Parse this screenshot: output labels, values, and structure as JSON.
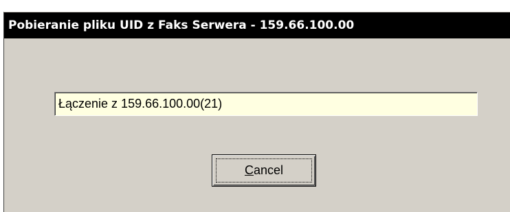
{
  "window": {
    "title": "Pobieranie pliku UID z Faks Serwera - 159.66.100.00"
  },
  "status": {
    "text": "Łączenie z 159.66.100.00(21)"
  },
  "buttons": {
    "cancel": {
      "mnemonic": "C",
      "rest": "ancel"
    }
  },
  "colors": {
    "titlebar": "#000000",
    "title_text": "#ffffff",
    "dialog_face": "#d4d0c8",
    "status_field": "#ffffe1"
  }
}
